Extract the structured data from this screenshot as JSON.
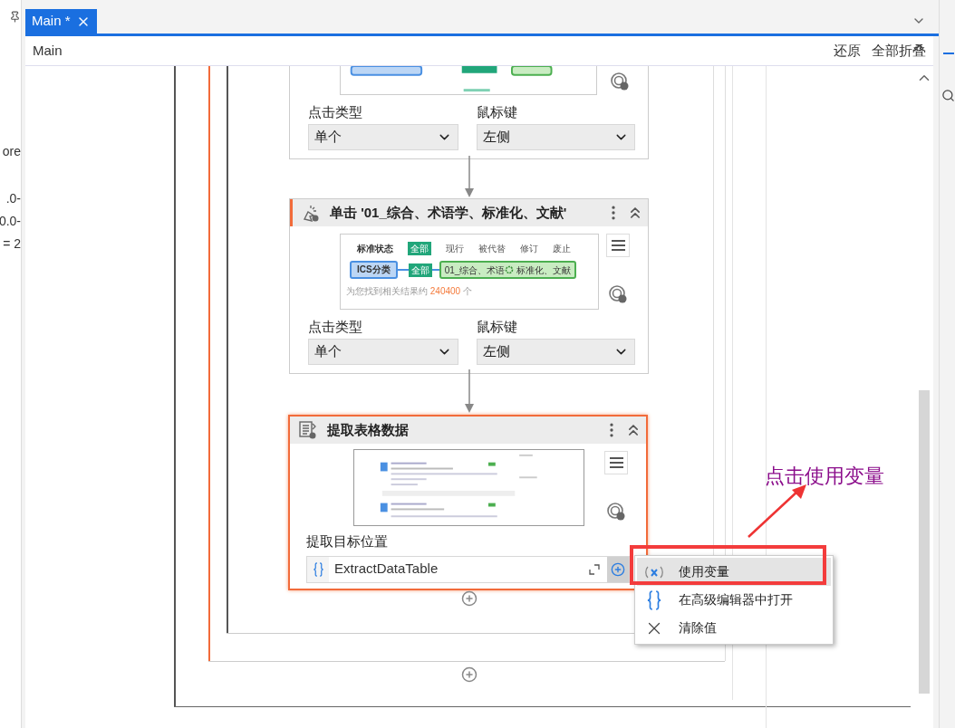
{
  "left_panel": {
    "lines": [
      "ore",
      ".0-",
      "0.0-",
      "= 2"
    ]
  },
  "tabs": [
    {
      "label": "Main *",
      "selected": true
    }
  ],
  "breadcrumb": "Main",
  "toolbar": [
    "还原",
    "全部折叠"
  ],
  "activities": [
    {
      "kind": "click",
      "selected": false,
      "fields": [
        {
          "label": "点击类型",
          "value": "单个"
        },
        {
          "label": "鼠标键",
          "value": "左侧"
        }
      ]
    },
    {
      "kind": "click",
      "selected": false,
      "title": "单击 '01_综合、术语学、标准化、文献'",
      "preview": {
        "heading": "标准状态",
        "filters": [
          {
            "label": "全部",
            "selected": true
          },
          {
            "label": "现行",
            "selected": false
          },
          {
            "label": "被代替",
            "selected": false
          },
          {
            "label": "修订",
            "selected": false
          },
          {
            "label": "废止",
            "selected": false
          }
        ],
        "row_label": "ICS分类",
        "row_badge": "全部",
        "target_start": "01_综合、术语",
        "target_end": "标准化、文献",
        "result_prefix": "为您找到相关结果约",
        "result_count": "240400",
        "result_suffix": "个"
      },
      "fields": [
        {
          "label": "点击类型",
          "value": "单个"
        },
        {
          "label": "鼠标键",
          "value": "左侧"
        }
      ]
    },
    {
      "kind": "extract",
      "selected": true,
      "title": "提取表格数据",
      "output_label": "提取目标位置",
      "output_value": "ExtractDataTable"
    }
  ],
  "context_menu": [
    {
      "kind": "variable",
      "label": "使用变量",
      "selected": true
    },
    {
      "kind": "editor",
      "label": "在高级编辑器中打开",
      "selected": false
    },
    {
      "kind": "clear",
      "label": "清除值",
      "selected": false
    }
  ],
  "annotation": "点击使用变量"
}
